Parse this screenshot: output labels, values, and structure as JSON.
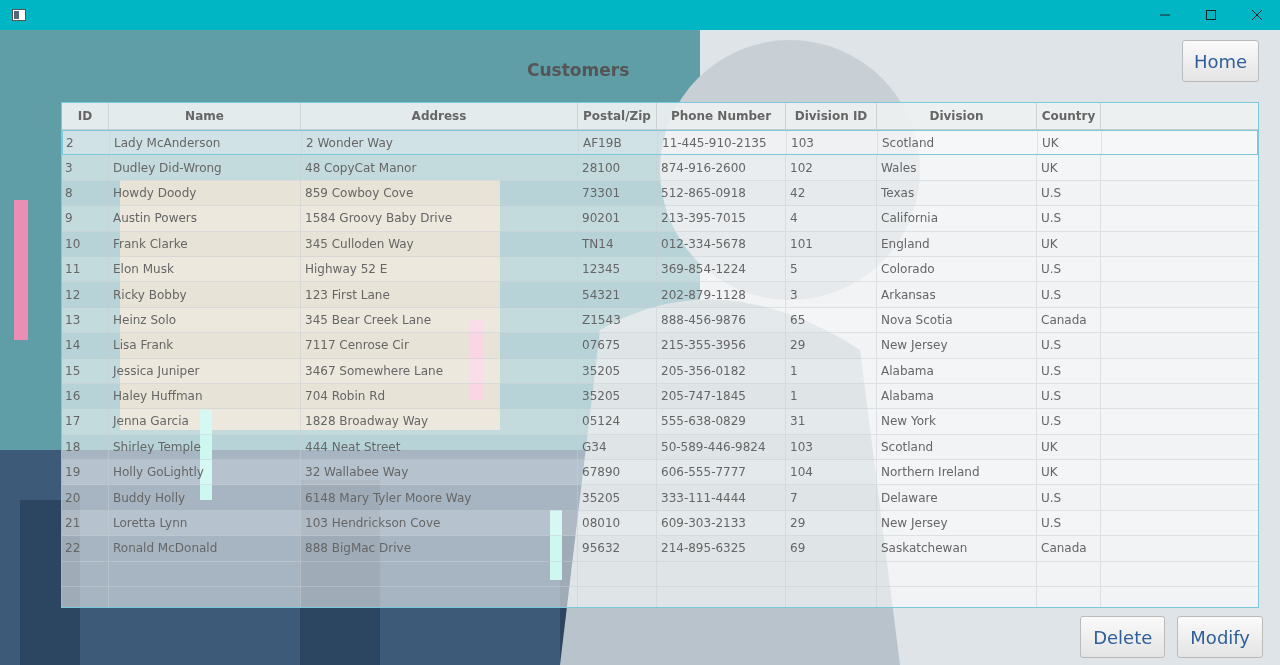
{
  "heading": "Customers",
  "home_button": "Home",
  "table": {
    "columns": [
      "ID",
      "Name",
      "Address",
      "Postal/Zip",
      "Phone Number",
      "Division ID",
      "Division",
      "Country"
    ],
    "rows": [
      {
        "selected": true,
        "cells": [
          "2",
          "Lady McAnderson",
          "2 Wonder Way",
          "AF19B",
          "11-445-910-2135",
          "103",
          "Scotland",
          "UK"
        ]
      },
      {
        "selected": false,
        "cells": [
          "3",
          "Dudley Did-Wrong",
          "48 CopyCat Manor",
          "28100",
          "874-916-2600",
          "102",
          "Wales",
          "UK"
        ]
      },
      {
        "selected": false,
        "cells": [
          "8",
          "Howdy Doody",
          "859 Cowboy Cove",
          "73301",
          "512-865-0918",
          "42",
          "Texas",
          "U.S"
        ]
      },
      {
        "selected": false,
        "cells": [
          "9",
          "Austin Powers",
          "1584 Groovy Baby Drive",
          "90201",
          "213-395-7015",
          "4",
          "California",
          "U.S"
        ]
      },
      {
        "selected": false,
        "cells": [
          "10",
          "Frank Clarke",
          "345 Culloden Way",
          "TN14",
          "012-334-5678",
          "101",
          "England",
          "UK"
        ]
      },
      {
        "selected": false,
        "cells": [
          "11",
          "Elon Musk",
          "Highway 52 E",
          "12345",
          "369-854-1224",
          "5",
          "Colorado",
          "U.S"
        ]
      },
      {
        "selected": false,
        "cells": [
          "12",
          "Ricky Bobby",
          "123 First Lane",
          "54321",
          "202-879-1128",
          "3",
          "Arkansas",
          "U.S"
        ]
      },
      {
        "selected": false,
        "cells": [
          "13",
          "Heinz Solo",
          "345 Bear Creek Lane",
          "Z1543",
          "888-456-9876",
          "65",
          "Nova Scotia",
          "Canada"
        ]
      },
      {
        "selected": false,
        "cells": [
          "14",
          "Lisa Frank",
          "7117 Cenrose  Cir",
          "07675",
          "215-355-3956",
          "29",
          "New Jersey",
          "U.S"
        ]
      },
      {
        "selected": false,
        "cells": [
          "15",
          "Jessica Juniper",
          "3467 Somewhere Lane",
          "35205",
          "205-356-0182",
          "1",
          "Alabama",
          "U.S"
        ]
      },
      {
        "selected": false,
        "cells": [
          "16",
          "Haley Huffman",
          "704 Robin Rd",
          "35205",
          "205-747-1845",
          "1",
          "Alabama",
          "U.S"
        ]
      },
      {
        "selected": false,
        "cells": [
          "17",
          "Jenna Garcia",
          "1828 Broadway Way",
          "05124",
          "555-638-0829",
          "31",
          "New York",
          "U.S"
        ]
      },
      {
        "selected": false,
        "cells": [
          "18",
          "Shirley Temple",
          "444 Neat Street",
          "G34",
          "50-589-446-9824",
          "103",
          "Scotland",
          "UK"
        ]
      },
      {
        "selected": false,
        "cells": [
          "19",
          "Holly GoLightly",
          "32 Wallabee Way",
          "67890",
          "606-555-7777",
          "104",
          "Northern Ireland",
          "UK"
        ]
      },
      {
        "selected": false,
        "cells": [
          "20",
          "Buddy Holly",
          "6148 Mary Tyler Moore Way",
          "35205",
          "333-111-4444",
          "7",
          "Delaware",
          "U.S"
        ]
      },
      {
        "selected": false,
        "cells": [
          "21",
          "Loretta Lynn",
          "103 Hendrickson Cove",
          "08010",
          "609-303-2133",
          "29",
          "New Jersey",
          "U.S"
        ]
      },
      {
        "selected": false,
        "cells": [
          "22",
          "Ronald McDonald",
          "888 BigMac Drive",
          "95632",
          "214-895-6325",
          "69",
          "Saskatchewan",
          "Canada"
        ]
      }
    ]
  },
  "actions": [
    "Delete",
    "Modify"
  ]
}
